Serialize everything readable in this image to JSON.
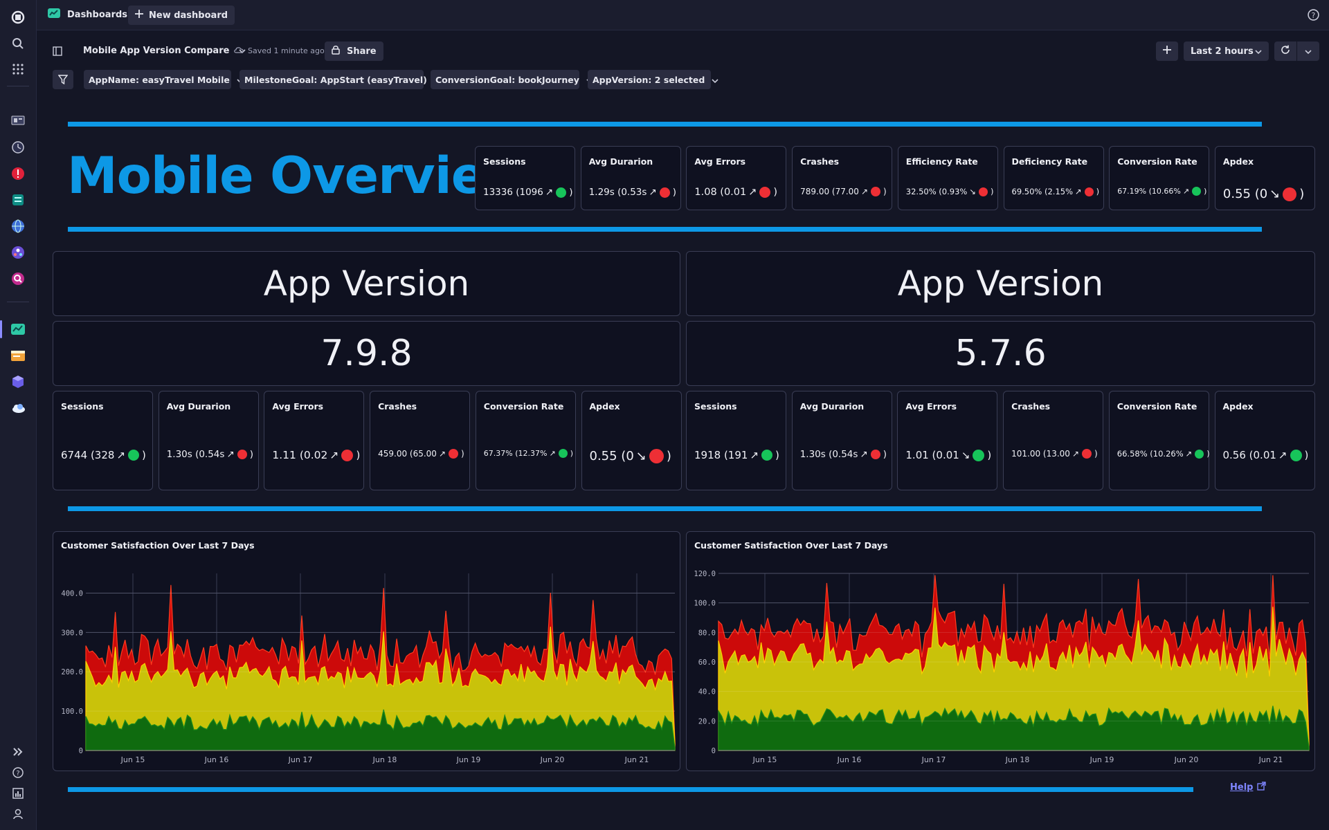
{
  "topbar": {
    "app_title": "Dashboards",
    "new_dashboard_label": "New dashboard"
  },
  "dashboard": {
    "title": "Mobile App Version Compare",
    "saved_text": "Saved 1 minute ago",
    "share_label": "Share",
    "timeframe": "Last 2 hours"
  },
  "filters": [
    {
      "label": "AppName: easyTravel Mobile"
    },
    {
      "label": "MilestoneGoal: AppStart (easyTravel)"
    },
    {
      "label": "ConversionGoal: bookJourney"
    },
    {
      "label": "AppVersion: 2 selected"
    }
  ],
  "overview": {
    "title": "Mobile Overview",
    "kpis": [
      {
        "label": "Sessions",
        "value": "13336 (1096",
        "arrow": "↗",
        "status": "green"
      },
      {
        "label": "Avg Durarion",
        "value": "1.29s (0.53s",
        "arrow": "↗",
        "status": "red"
      },
      {
        "label": "Avg Errors",
        "value": "1.08 (0.01",
        "arrow": "↗",
        "status": "red"
      },
      {
        "label": "Crashes",
        "value": "789.00 (77.00",
        "arrow": "↗",
        "status": "red"
      },
      {
        "label": "Efficiency Rate",
        "value": "32.50% (0.93%",
        "arrow": "↘",
        "status": "red"
      },
      {
        "label": "Deficiency Rate",
        "value": "69.50% (2.15%",
        "arrow": "↗",
        "status": "red"
      },
      {
        "label": "Conversion Rate",
        "value": "67.19% (10.66%",
        "arrow": "↗",
        "status": "green"
      },
      {
        "label": "Apdex",
        "value": "0.55 (0",
        "arrow": "↘",
        "status": "red"
      }
    ]
  },
  "versions": [
    {
      "heading": "App Version",
      "version": "7.9.8",
      "kpis": [
        {
          "label": "Sessions",
          "value": "6744 (328",
          "arrow": "↗",
          "status": "green"
        },
        {
          "label": "Avg Durarion",
          "value": "1.30s (0.54s",
          "arrow": "↗",
          "status": "red"
        },
        {
          "label": "Avg Errors",
          "value": "1.11 (0.02",
          "arrow": "↗",
          "status": "red"
        },
        {
          "label": "Crashes",
          "value": "459.00 (65.00",
          "arrow": "↗",
          "status": "red"
        },
        {
          "label": "Conversion Rate",
          "value": "67.37% (12.37%",
          "arrow": "↗",
          "status": "green"
        },
        {
          "label": "Apdex",
          "value": "0.55 (0",
          "arrow": "↘",
          "status": "red"
        }
      ]
    },
    {
      "heading": "App Version",
      "version": "5.7.6",
      "kpis": [
        {
          "label": "Sessions",
          "value": "1918 (191",
          "arrow": "↗",
          "status": "green"
        },
        {
          "label": "Avg Durarion",
          "value": "1.30s (0.54s",
          "arrow": "↗",
          "status": "red"
        },
        {
          "label": "Avg Errors",
          "value": "1.01 (0.01",
          "arrow": "↘",
          "status": "green"
        },
        {
          "label": "Crashes",
          "value": "101.00 (13.00",
          "arrow": "↗",
          "status": "red"
        },
        {
          "label": "Conversion Rate",
          "value": "66.58% (10.26%",
          "arrow": "↗",
          "status": "green"
        },
        {
          "label": "Apdex",
          "value": "0.56 (0.01",
          "arrow": "↗",
          "status": "green"
        }
      ]
    }
  ],
  "chart_data": [
    {
      "type": "area",
      "title": "Customer Satisfaction Over Last 7 Days",
      "x_ticks": [
        "Jun 15",
        "Jun 16",
        "Jun 17",
        "Jun 18",
        "Jun 19",
        "Jun 20",
        "Jun 21"
      ],
      "y_ticks": [
        "0",
        "100.0",
        "200.0",
        "300.0",
        "400.0"
      ],
      "ylim": [
        0,
        450
      ],
      "stacked": true,
      "grid": true,
      "series_colors": [
        "#0f6b0f",
        "#c9c20a",
        "#cc0a0a"
      ],
      "approx_levels": {
        "satisfied": 70,
        "tolerating": 120,
        "frustrated": 60
      },
      "spikes": [
        {
          "x": "Jun 14 19:00",
          "total": 340
        },
        {
          "x": "Jun 15 11:00",
          "total": 400
        },
        {
          "x": "Jun 17 00:00",
          "total": 330
        },
        {
          "x": "Jun 18 00:00",
          "total": 395
        },
        {
          "x": "Jun 18 18:00",
          "total": 340
        },
        {
          "x": "Jun 20 00:00",
          "total": 380
        },
        {
          "x": "Jun 20 12:00",
          "total": 365
        },
        {
          "x": "Jun 21 12:00",
          "total": 320
        }
      ]
    },
    {
      "type": "area",
      "title": "Customer Satisfaction Over Last 7 Days",
      "x_ticks": [
        "Jun 15",
        "Jun 16",
        "Jun 17",
        "Jun 18",
        "Jun 19",
        "Jun 20",
        "Jun 21"
      ],
      "y_ticks": [
        "0",
        "20.0",
        "40.0",
        "60.0",
        "80.0",
        "100.0",
        "120.0"
      ],
      "ylim": [
        0,
        120
      ],
      "stacked": true,
      "grid": true,
      "series_colors": [
        "#0f6b0f",
        "#c9c20a",
        "#cc0a0a"
      ],
      "approx_levels": {
        "satisfied": 22,
        "tolerating": 40,
        "frustrated": 18
      },
      "spikes": [
        {
          "x": "Jun 15 18:00",
          "total": 110
        },
        {
          "x": "Jun 17 00:00",
          "total": 118
        },
        {
          "x": "Jun 17 20:00",
          "total": 108
        },
        {
          "x": "Jun 19 10:00",
          "total": 112
        },
        {
          "x": "Jun 21 00:00",
          "total": 115
        }
      ]
    }
  ],
  "help_label": "Help"
}
